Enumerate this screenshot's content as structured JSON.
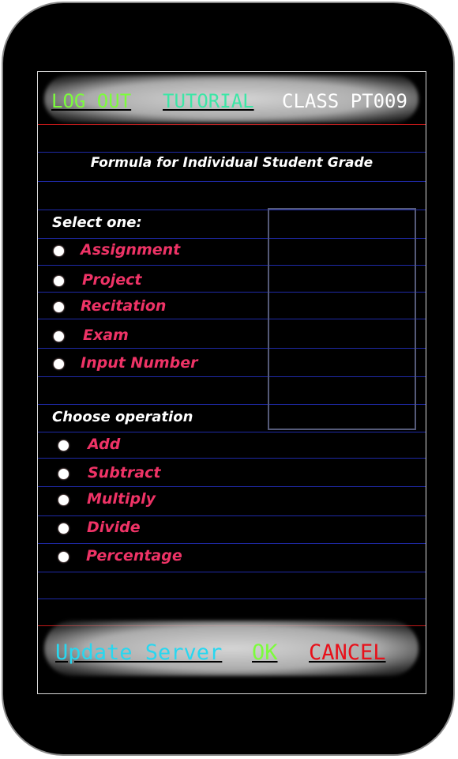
{
  "header": {
    "logout_label": "LOG OUT",
    "tutorial_label": "TUTORIAL",
    "class_label": "CLASS PT009"
  },
  "title": "Formula for Individual Student Grade",
  "select_section": {
    "label": "Select one:",
    "options": [
      "Assignment",
      "Project",
      "Recitation",
      "Exam",
      "Input Number"
    ]
  },
  "operation_section": {
    "label": "Choose operation",
    "options": [
      "Add",
      "Subtract",
      "Multiply",
      "Divide",
      "Percentage"
    ]
  },
  "footer": {
    "update_label": "Update Server",
    "ok_label": "OK",
    "cancel_label": "CANCEL"
  },
  "colors": {
    "logout": "#7cfc3c",
    "tutorial": "#3ce6a6",
    "class": "#ffffff",
    "option_text": "#ee3366",
    "update": "#28d7f0",
    "ok": "#7cfc3c",
    "cancel": "#e8101a"
  }
}
